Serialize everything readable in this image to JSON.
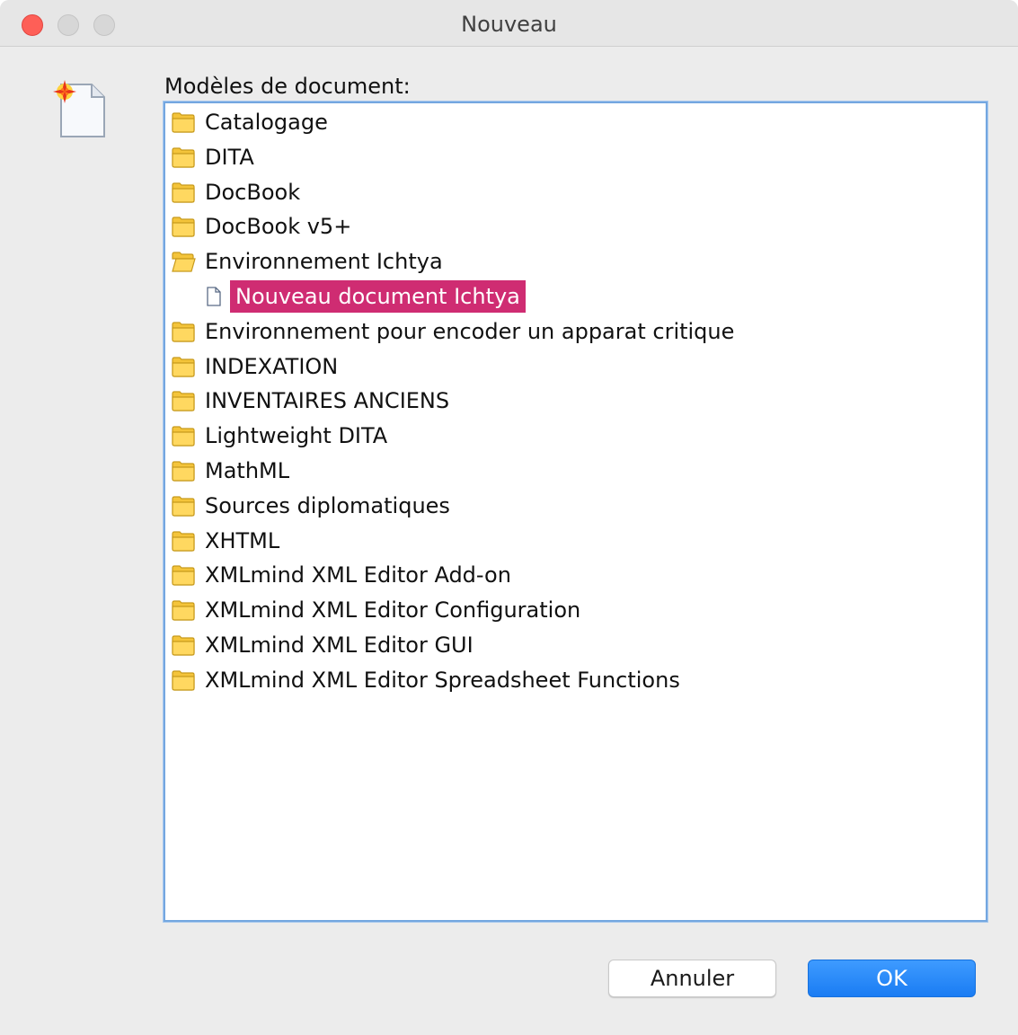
{
  "window": {
    "title": "Nouveau"
  },
  "dialog": {
    "list_label": "Modèles de document:",
    "tree": [
      {
        "label": "Catalogage",
        "kind": "folder",
        "expanded": false
      },
      {
        "label": "DITA",
        "kind": "folder",
        "expanded": false
      },
      {
        "label": "DocBook",
        "kind": "folder",
        "expanded": false
      },
      {
        "label": "DocBook v5+",
        "kind": "folder",
        "expanded": false
      },
      {
        "label": "Environnement Ichtya",
        "kind": "folder",
        "expanded": true
      },
      {
        "label": "Nouveau document Ichtya",
        "kind": "document",
        "selected": true
      },
      {
        "label": "Environnement pour encoder un apparat critique",
        "kind": "folder",
        "expanded": false
      },
      {
        "label": "INDEXATION",
        "kind": "folder",
        "expanded": false
      },
      {
        "label": "INVENTAIRES ANCIENS",
        "kind": "folder",
        "expanded": false
      },
      {
        "label": "Lightweight DITA",
        "kind": "folder",
        "expanded": false
      },
      {
        "label": "MathML",
        "kind": "folder",
        "expanded": false
      },
      {
        "label": "Sources diplomatiques",
        "kind": "folder",
        "expanded": false
      },
      {
        "label": "XHTML",
        "kind": "folder",
        "expanded": false
      },
      {
        "label": "XMLmind XML Editor Add-on",
        "kind": "folder",
        "expanded": false
      },
      {
        "label": "XMLmind XML Editor Configuration",
        "kind": "folder",
        "expanded": false
      },
      {
        "label": "XMLmind XML Editor GUI",
        "kind": "folder",
        "expanded": false
      },
      {
        "label": "XMLmind XML Editor Spreadsheet Functions",
        "kind": "folder",
        "expanded": false
      }
    ],
    "cancel_label": "Annuler",
    "ok_label": "OK"
  },
  "colors": {
    "selection": "#cf2c72",
    "default_button": "#1a7cf3",
    "focus_border": "#74a7e0"
  }
}
